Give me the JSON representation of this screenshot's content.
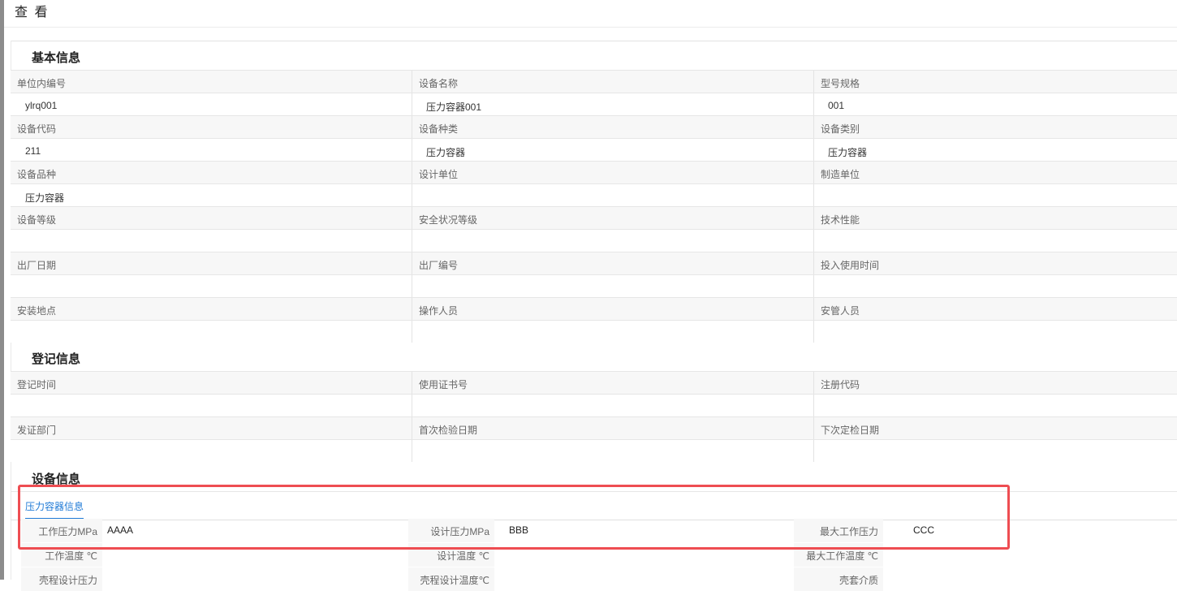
{
  "dialog": {
    "title": "查 看"
  },
  "sections": {
    "basic": "基本信息",
    "register": "登记信息",
    "device": "设备信息"
  },
  "basic_rows": [
    {
      "labels": [
        "单位内编号",
        "设备名称",
        "型号规格"
      ],
      "values": [
        "ylrq001",
        "压力容器001",
        "001"
      ]
    },
    {
      "labels": [
        "设备代码",
        "设备种类",
        "设备类别"
      ],
      "values": [
        "211",
        "压力容器",
        "压力容器"
      ]
    },
    {
      "labels": [
        "设备品种",
        "设计单位",
        "制造单位"
      ],
      "values": [
        "压力容器",
        "",
        ""
      ]
    },
    {
      "labels": [
        "设备等级",
        "安全状况等级",
        "技术性能"
      ],
      "values": [
        "",
        "",
        ""
      ]
    },
    {
      "labels": [
        "出厂日期",
        "出厂编号",
        "投入使用时间"
      ],
      "values": [
        "",
        "",
        ""
      ]
    },
    {
      "labels": [
        "安装地点",
        "操作人员",
        "安管人员"
      ],
      "values": [
        "",
        "",
        ""
      ]
    }
  ],
  "register_rows": [
    {
      "labels": [
        "登记时间",
        "使用证书号",
        "注册代码"
      ],
      "values": [
        "",
        "",
        ""
      ]
    },
    {
      "labels": [
        "发证部门",
        "首次检验日期",
        "下次定检日期"
      ],
      "values": [
        "",
        "",
        ""
      ]
    }
  ],
  "device_tabs": [
    {
      "label": "压力容器信息",
      "active": true
    }
  ],
  "device_rows": [
    {
      "items": [
        {
          "label": "工作压力MPa",
          "value": "AAAA"
        },
        {
          "label": "设计压力MPa",
          "value": "BBB"
        },
        {
          "label": "最大工作压力",
          "value": "CCC"
        }
      ]
    },
    {
      "items": [
        {
          "label": "工作温度 ℃",
          "value": ""
        },
        {
          "label": "设计温度 ℃",
          "value": ""
        },
        {
          "label": "最大工作温度 ℃",
          "value": ""
        }
      ]
    },
    {
      "items": [
        {
          "label": "壳程设计压力",
          "value": ""
        },
        {
          "label": "壳程设计温度℃",
          "value": ""
        },
        {
          "label": "壳套介质",
          "value": ""
        }
      ]
    }
  ],
  "colors": {
    "accent": "#1f7ad6",
    "highlight": "#ee4d52"
  }
}
